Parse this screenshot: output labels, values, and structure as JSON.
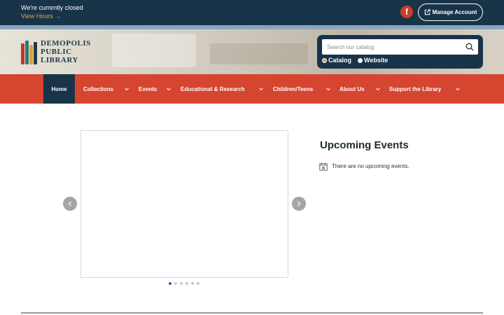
{
  "topbar": {
    "status": "We're currently closed",
    "hours_link": "View Hours →",
    "facebook_glyph": "f",
    "manage_account": "Manage Account"
  },
  "logo": {
    "line1": "DEMOPOLIS",
    "line2": "PUBLIC",
    "line3": "LIBRARY"
  },
  "search": {
    "placeholder": "Search our catalog",
    "options": [
      "Catalog",
      "Website"
    ],
    "selected": "Catalog"
  },
  "nav": {
    "items": [
      {
        "label": "Home",
        "active": true
      },
      {
        "label": "Collections",
        "dropdown": true
      },
      {
        "label": "Events",
        "dropdown": true
      },
      {
        "label": "Educational & Research",
        "dropdown": true
      },
      {
        "label": "Children/Teens",
        "dropdown": true
      },
      {
        "label": "About Us",
        "dropdown": true
      },
      {
        "label": "Support the Library",
        "dropdown": true
      }
    ]
  },
  "slider": {
    "slide_count": 6,
    "current": 1
  },
  "events": {
    "title": "Upcoming Events",
    "empty_text": "There are no upcoming events."
  },
  "colors": {
    "dark_navy": "#173449",
    "nav_red": "#d64530",
    "accent_gold": "#d9a84a",
    "dot_active": "#2d6aa3"
  }
}
